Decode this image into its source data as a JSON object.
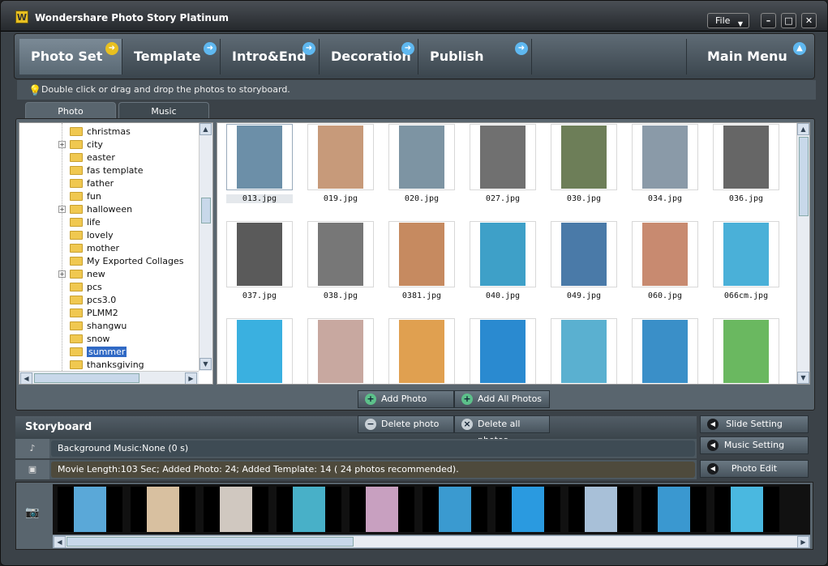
{
  "app": {
    "title": "Wondershare Photo Story Platinum",
    "icon_glyph": "W",
    "file_menu": "File"
  },
  "window_controls": {
    "minimize": "–",
    "maximize": "□",
    "close": "✕"
  },
  "nav": {
    "tabs": [
      {
        "label": "Photo Set",
        "active": true
      },
      {
        "label": "Template",
        "active": false
      },
      {
        "label": "Intro&End",
        "active": false
      },
      {
        "label": "Decoration",
        "active": false
      },
      {
        "label": "Publish",
        "active": false
      }
    ],
    "main_menu": "Main Menu"
  },
  "hint": "Double click or drag and drop the photos to storyboard.",
  "panel_tabs": {
    "photo": "Photo",
    "music": "Music"
  },
  "tree": {
    "items": [
      {
        "label": "christmas",
        "expandable": false,
        "selected": false
      },
      {
        "label": "city",
        "expandable": true,
        "selected": false
      },
      {
        "label": "easter",
        "expandable": false,
        "selected": false
      },
      {
        "label": "fas template",
        "expandable": false,
        "selected": false
      },
      {
        "label": "father",
        "expandable": false,
        "selected": false
      },
      {
        "label": "fun",
        "expandable": false,
        "selected": false
      },
      {
        "label": "halloween",
        "expandable": true,
        "selected": false
      },
      {
        "label": "life",
        "expandable": false,
        "selected": false
      },
      {
        "label": "lovely",
        "expandable": false,
        "selected": false
      },
      {
        "label": "mother",
        "expandable": false,
        "selected": false
      },
      {
        "label": "My Exported Collages",
        "expandable": false,
        "selected": false
      },
      {
        "label": "new",
        "expandable": true,
        "selected": false
      },
      {
        "label": "pcs",
        "expandable": false,
        "selected": false
      },
      {
        "label": "pcs3.0",
        "expandable": false,
        "selected": false
      },
      {
        "label": "PLMM2",
        "expandable": false,
        "selected": false
      },
      {
        "label": "shangwu",
        "expandable": false,
        "selected": false
      },
      {
        "label": "snow",
        "expandable": false,
        "selected": false
      },
      {
        "label": "summer",
        "expandable": false,
        "selected": true
      },
      {
        "label": "thanksgiving",
        "expandable": false,
        "selected": false
      }
    ]
  },
  "photos": [
    {
      "name": "013.jpg",
      "color": "#6c8fa8"
    },
    {
      "name": "019.jpg",
      "color": "#c79a7a"
    },
    {
      "name": "020.jpg",
      "color": "#7d94a3"
    },
    {
      "name": "027.jpg",
      "color": "#707070"
    },
    {
      "name": "030.jpg",
      "color": "#6d7e58"
    },
    {
      "name": "034.jpg",
      "color": "#8a9aa8"
    },
    {
      "name": "036.jpg",
      "color": "#666666"
    },
    {
      "name": "037.jpg",
      "color": "#5a5a5a"
    },
    {
      "name": "038.jpg",
      "color": "#777777"
    },
    {
      "name": "0381.jpg",
      "color": "#c68a60"
    },
    {
      "name": "040.jpg",
      "color": "#3ea0c8"
    },
    {
      "name": "049.jpg",
      "color": "#4a7aa8"
    },
    {
      "name": "060.jpg",
      "color": "#c88a70"
    },
    {
      "name": "066cm.jpg",
      "color": "#4ab0d8"
    },
    {
      "name": "",
      "color": "#3ab0e0"
    },
    {
      "name": "",
      "color": "#c8a8a0"
    },
    {
      "name": "",
      "color": "#e0a050"
    },
    {
      "name": "",
      "color": "#2a8ad0"
    },
    {
      "name": "",
      "color": "#5ab0d0"
    },
    {
      "name": "",
      "color": "#3a8fc8"
    },
    {
      "name": "",
      "color": "#6ab860"
    }
  ],
  "actions": {
    "add_photo": "Add Photo",
    "add_all_photos": "Add All Photos",
    "delete_photo": "Delete photo",
    "delete_all_photos": "Delete all photos"
  },
  "storyboard": {
    "title": "Storyboard",
    "background_music": "Background Music:None (0 s)",
    "movie_info": "Movie Length:103 Sec;    Added Photo: 24;    Added Template: 14    ( 24 photos recommended).",
    "frames": [
      "#5aa8d8",
      "#d8c0a0",
      "#d0c8c0",
      "#48b0c8",
      "#c8a0c0",
      "#3a9ad0",
      "#2a9ae0",
      "#a8c0d8",
      "#3a98d0",
      "#4ab8e0"
    ]
  },
  "side_buttons": {
    "slide_setting": "Slide Setting",
    "music_setting": "Music Setting",
    "photo_edit": "Photo Edit"
  }
}
